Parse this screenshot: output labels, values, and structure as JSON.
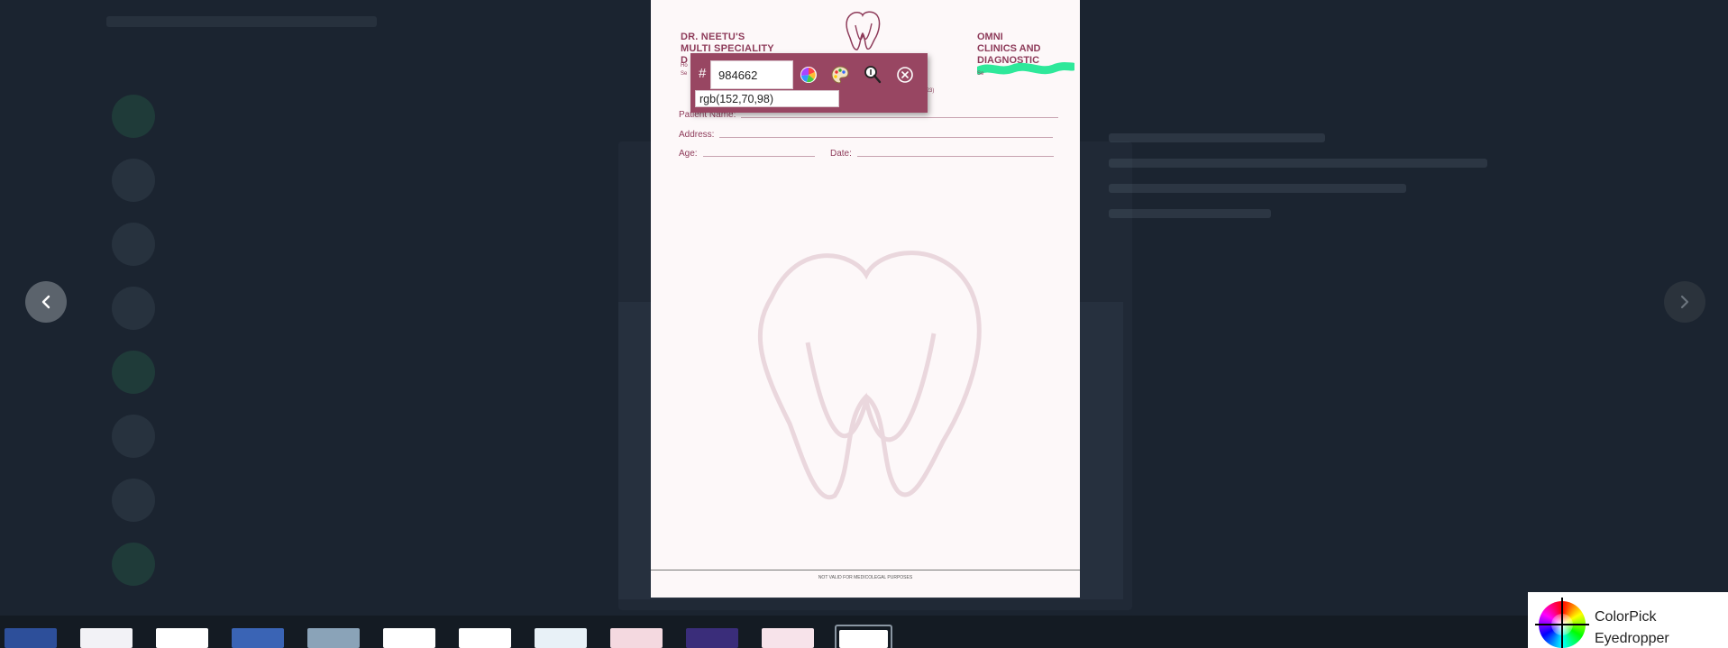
{
  "background": {
    "contacts": [
      {
        "name": "",
        "sub": "",
        "highlight": true
      },
      {
        "name": "",
        "sub": "",
        "highlight": false
      },
      {
        "name": "",
        "sub": "",
        "highlight": false
      },
      {
        "name": "",
        "sub": "",
        "highlight": false
      },
      {
        "name": "",
        "sub": "",
        "highlight": true
      },
      {
        "name": "",
        "sub": "",
        "highlight": false
      },
      {
        "name": "",
        "sub": "",
        "highlight": false
      },
      {
        "name": "",
        "sub": "",
        "highlight": true
      }
    ]
  },
  "viewer": {
    "prev_icon": "chevron-left-icon",
    "next_icon": "chevron-right-icon"
  },
  "document": {
    "header_left": [
      "DR. NEETU'S",
      "MULTI SPECIALITY",
      "D"
    ],
    "header_left_small": [
      "Ho",
      "Se"
    ],
    "header_right": [
      "OMNI",
      "CLINICS AND",
      "DIAGNOSTIC"
    ],
    "header_right_small": "Se",
    "header_mid_small": "-2023)",
    "fields": {
      "patient_name": "Patient Name:",
      "address": "Address:",
      "age": "Age:",
      "date": "Date:"
    },
    "footer": "NOT VALID FOR MEDICOLEGAL PURPOSES",
    "brand_color": "#8e3b5a"
  },
  "picker": {
    "hash": "#",
    "hex_value": "984662",
    "rgb_value": "rgb(152,70,98)",
    "swatch_color": "#984662",
    "icons": [
      "color-wheel-icon",
      "palette-icon",
      "zoom-icon",
      "close-icon"
    ]
  },
  "thumbnails": [
    {
      "color": "#2d4f9a",
      "active": false
    },
    {
      "color": "#f2f2f6",
      "active": false
    },
    {
      "color": "#ffffff",
      "active": false
    },
    {
      "color": "#3a64b5",
      "active": false
    },
    {
      "color": "#8aa3b8",
      "active": false
    },
    {
      "color": "#ffffff",
      "active": false
    },
    {
      "color": "#ffffff",
      "active": false
    },
    {
      "color": "#e8f1f7",
      "active": false
    },
    {
      "color": "#f4d9e0",
      "active": false
    },
    {
      "color": "#3a2d7a",
      "active": false
    },
    {
      "color": "#f7e3ea",
      "active": false
    },
    {
      "color": "#ffffff",
      "active": true
    }
  ],
  "notification": {
    "line1": "ColorPick",
    "line2": "Eyedropper"
  }
}
